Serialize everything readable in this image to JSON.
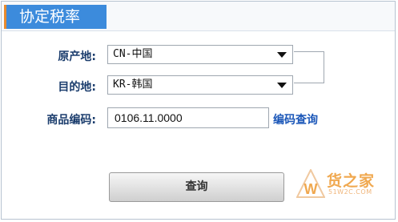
{
  "panel": {
    "title": "协定税率"
  },
  "form": {
    "origin_label": "原产地:",
    "origin_value": "CN-中国",
    "destination_label": "目的地:",
    "destination_value": "KR-韩国",
    "code_label": "商品编码:",
    "code_value": "0106.11.0000",
    "code_lookup_link": "编码查询",
    "query_button": "查询"
  },
  "watermark": {
    "brand": "货之家",
    "letter": "W",
    "site": "51W2C.COM"
  },
  "icons": {
    "dropdown": "chevron-down-icon",
    "watermark": "logo-icon"
  },
  "colors": {
    "accent": "#3c8bdc",
    "tab_stripe": "#e88a2e",
    "label": "#1b3d6d",
    "link": "#1a56b8"
  }
}
